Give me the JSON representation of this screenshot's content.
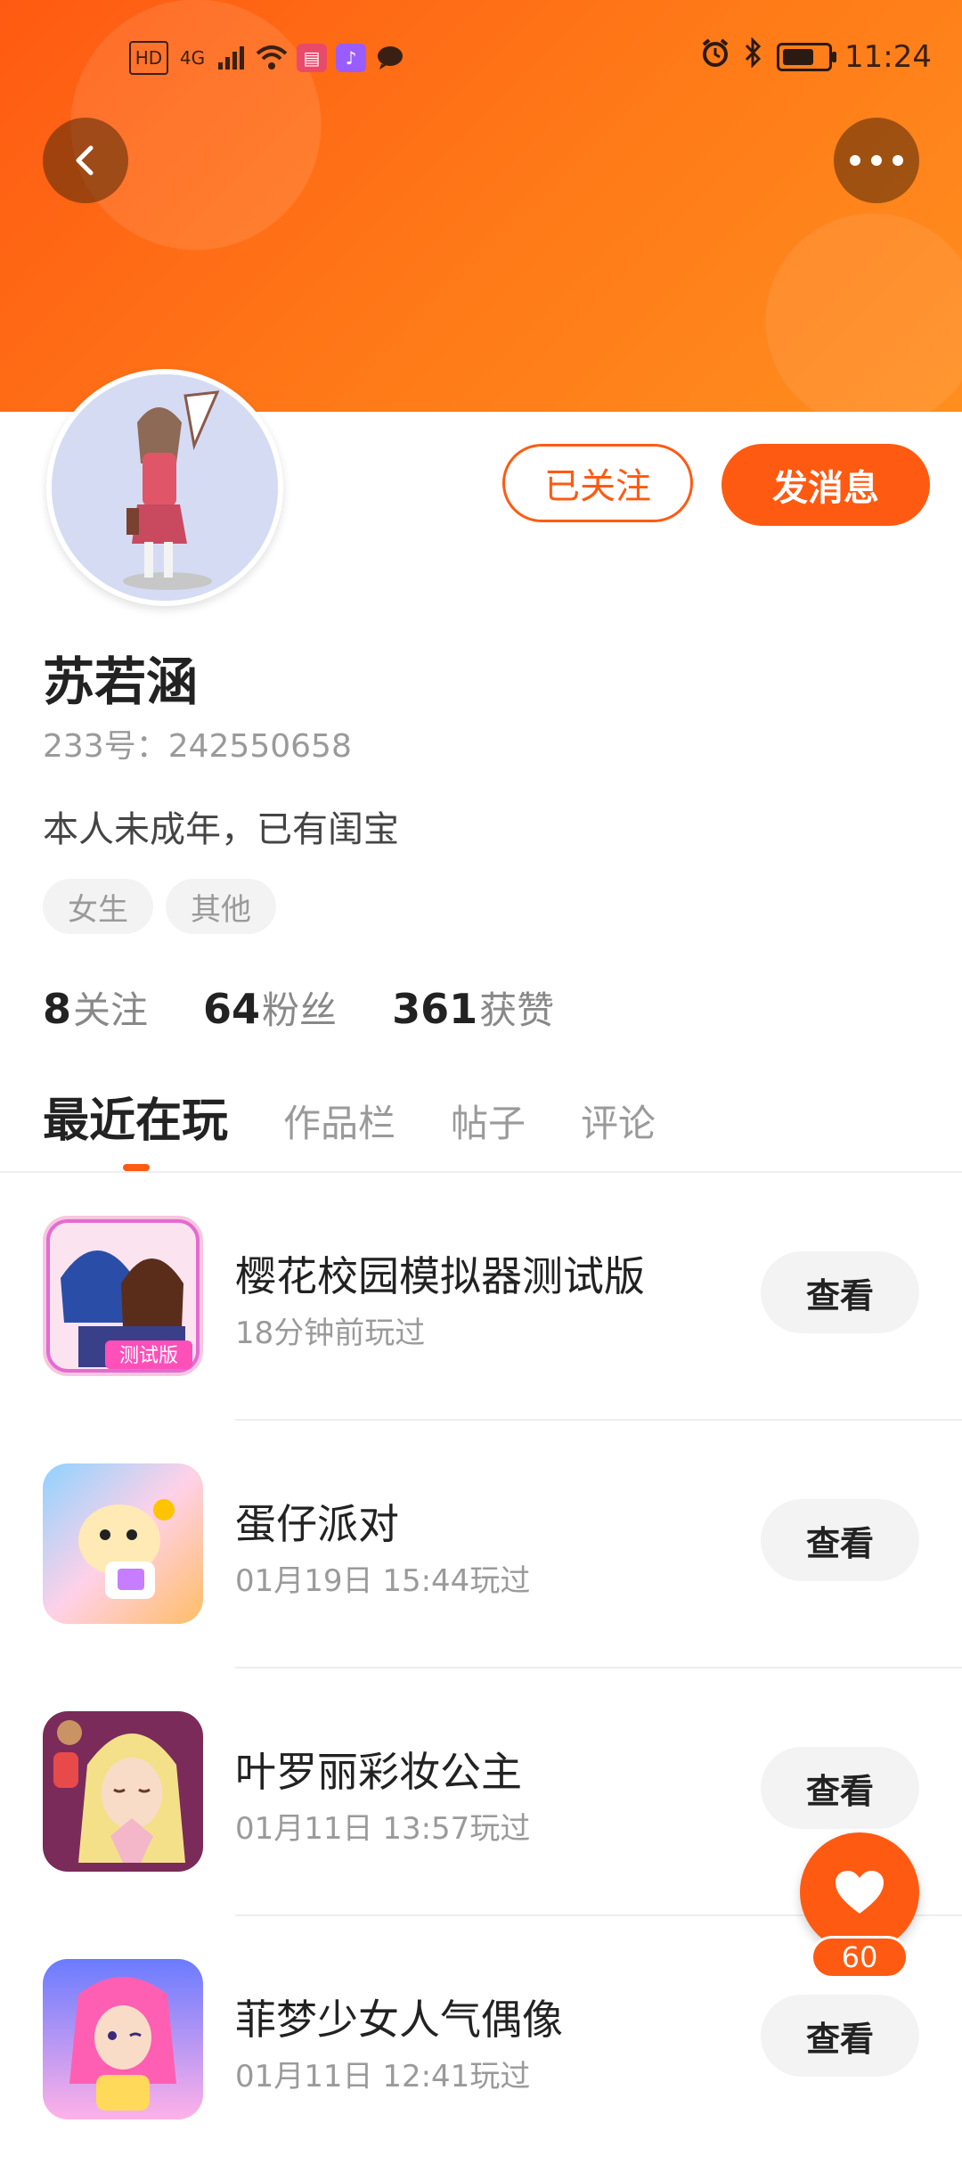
{
  "status_bar": {
    "left_labels": [
      "HD",
      "4G"
    ],
    "time": "11:24"
  },
  "header": {
    "back_icon": "chevron-left-icon",
    "more_icon": "more-dots-icon",
    "bg_color": "#ff7a18"
  },
  "profile": {
    "name": "苏若涵",
    "uid": "233号：242550658",
    "bio": "本人未成年，已有闺宝",
    "tags": [
      "女生",
      "其他"
    ],
    "follow_label": "已关注",
    "message_label": "发消息",
    "stats": [
      {
        "value": "8",
        "label": "关注"
      },
      {
        "value": "64",
        "label": "粉丝"
      },
      {
        "value": "361",
        "label": "获赞"
      }
    ]
  },
  "tabs": [
    {
      "label": "最近在玩",
      "active": true
    },
    {
      "label": "作品栏",
      "active": false
    },
    {
      "label": "帖子",
      "active": false
    },
    {
      "label": "评论",
      "active": false
    }
  ],
  "games": [
    {
      "title": "樱花校园模拟器测试版",
      "played": "18分钟前玩过",
      "button": "查看",
      "icon": "sakura-school-icon"
    },
    {
      "title": "蛋仔派对",
      "played": "01月19日 15:44玩过",
      "button": "查看",
      "icon": "eggy-party-icon"
    },
    {
      "title": "叶罗丽彩妆公主",
      "played": "01月11日 13:57玩过",
      "button": "查看",
      "icon": "yeloli-makeup-icon"
    },
    {
      "title": "菲梦少女人气偶像",
      "played": "01月11日 12:41玩过",
      "button": "查看",
      "icon": "feimeng-idol-icon"
    }
  ],
  "fab": {
    "icon": "heart-icon",
    "count": "60"
  }
}
